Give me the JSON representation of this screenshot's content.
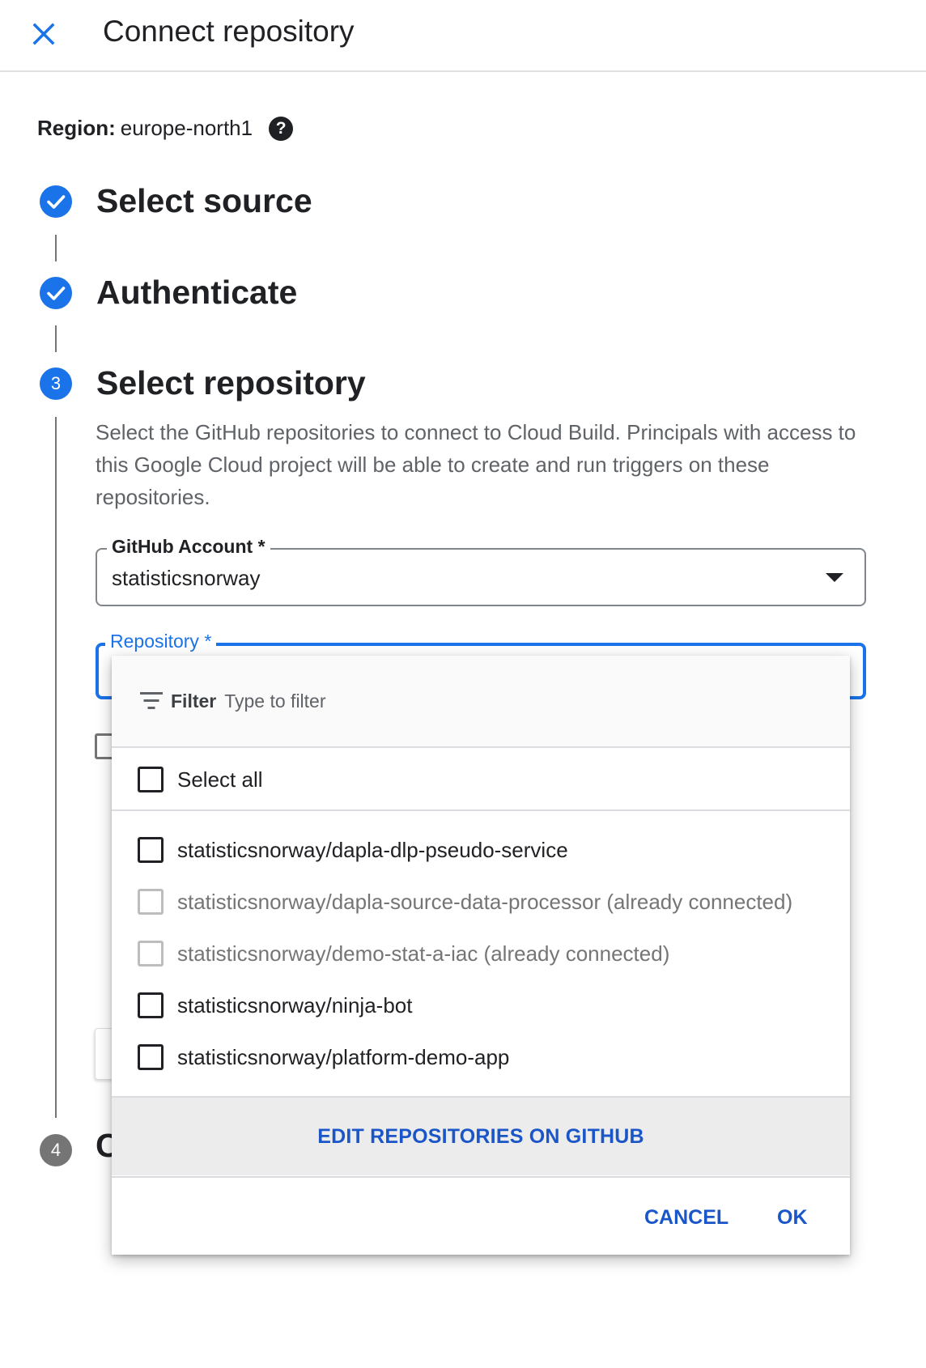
{
  "header": {
    "title": "Connect repository",
    "close_icon": "close-icon"
  },
  "region": {
    "label": "Region:",
    "value": "europe-north1",
    "help_icon": "?"
  },
  "steps": [
    {
      "title": "Select source",
      "status": "done"
    },
    {
      "title": "Authenticate",
      "status": "done"
    },
    {
      "number": "3",
      "title": "Select repository",
      "status": "active"
    },
    {
      "number": "4",
      "title": "C",
      "status": "pending"
    }
  ],
  "description": "Select the GitHub repositories to connect to Cloud Build. Principals with access to this Google Cloud project will be able to create and run triggers on these repositories.",
  "github_account": {
    "label": "GitHub Account *",
    "value": "statisticsnorway"
  },
  "repository": {
    "label": "Repository *"
  },
  "dropdown": {
    "filter_label": "Filter",
    "filter_placeholder": "Type to filter",
    "select_all": "Select all",
    "repos": [
      {
        "label": "statisticsnorway/dapla-dlp-pseudo-service",
        "disabled": false,
        "checked": false
      },
      {
        "label": "statisticsnorway/dapla-source-data-processor (already connected)",
        "disabled": true,
        "checked": false
      },
      {
        "label": "statisticsnorway/demo-stat-a-iac (already connected)",
        "disabled": true,
        "checked": false
      },
      {
        "label": "statisticsnorway/ninja-bot",
        "disabled": false,
        "checked": false
      },
      {
        "label": "statisticsnorway/platform-demo-app",
        "disabled": false,
        "checked": false
      }
    ],
    "edit_link": "EDIT REPOSITORIES ON GITHUB",
    "cancel": "CANCEL",
    "ok": "OK"
  },
  "colors": {
    "accent": "#1a73e8",
    "link": "#1a56c7",
    "pending_step": "#757575"
  }
}
